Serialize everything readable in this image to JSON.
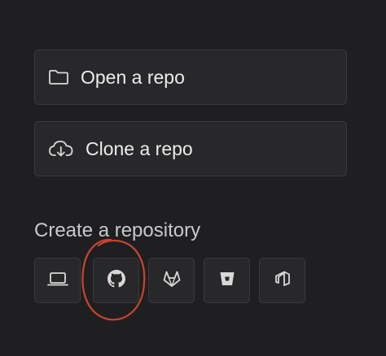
{
  "actions": {
    "open_label": "Open a repo",
    "clone_label": "Clone a repo"
  },
  "create": {
    "title": "Create a repository",
    "providers": [
      "local-computer-icon",
      "github-icon",
      "gitlab-icon",
      "bitbucket-icon",
      "azure-devops-icon"
    ]
  },
  "colors": {
    "background": "#1f1f21",
    "button_bg": "#28282a",
    "button_border": "#3a3a3d",
    "text": "#ececec",
    "annotation": "#c8442f"
  }
}
